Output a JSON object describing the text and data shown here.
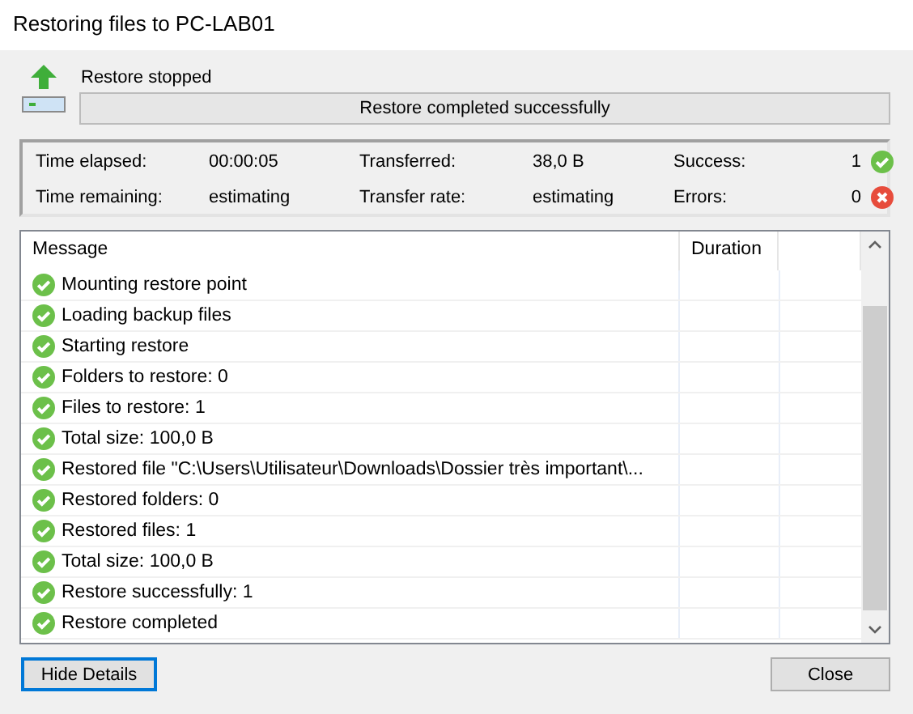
{
  "window": {
    "title": "Restoring files to PC-LAB01"
  },
  "status": {
    "label": "Restore stopped",
    "progress_text": "Restore completed successfully"
  },
  "stats": [
    {
      "label": "Time elapsed:",
      "value": "00:00:05"
    },
    {
      "label": "Transferred:",
      "value": "38,0 B"
    },
    {
      "label": "Success:",
      "value": "1",
      "kind": "success"
    },
    {
      "label": "Time remaining:",
      "value": "estimating"
    },
    {
      "label": "Transfer rate:",
      "value": "estimating"
    },
    {
      "label": "Errors:",
      "value": "0",
      "kind": "error"
    }
  ],
  "log": {
    "columns": [
      "Message",
      "Duration"
    ],
    "rows": [
      {
        "message": "Mounting restore point",
        "kind": "success"
      },
      {
        "message": "Loading backup files",
        "kind": "success"
      },
      {
        "message": "Starting restore",
        "kind": "success"
      },
      {
        "message": "Folders to restore: 0",
        "kind": "success"
      },
      {
        "message": "Files to restore: 1",
        "kind": "success"
      },
      {
        "message": "Total size: 100,0 B",
        "kind": "success"
      },
      {
        "message": "Restored file \"C:\\Users\\Utilisateur\\Downloads\\Dossier très important\\...",
        "kind": "success"
      },
      {
        "message": "Restored folders: 0",
        "kind": "success"
      },
      {
        "message": "Restored files: 1",
        "kind": "success"
      },
      {
        "message": "Total size: 100,0 B",
        "kind": "success"
      },
      {
        "message": "Restore successfully: 1",
        "kind": "success"
      },
      {
        "message": "Restore completed",
        "kind": "success"
      }
    ]
  },
  "buttons": [
    {
      "label": "Hide Details",
      "kind": "focused"
    },
    {
      "label": "Close",
      "kind": "normal"
    }
  ]
}
